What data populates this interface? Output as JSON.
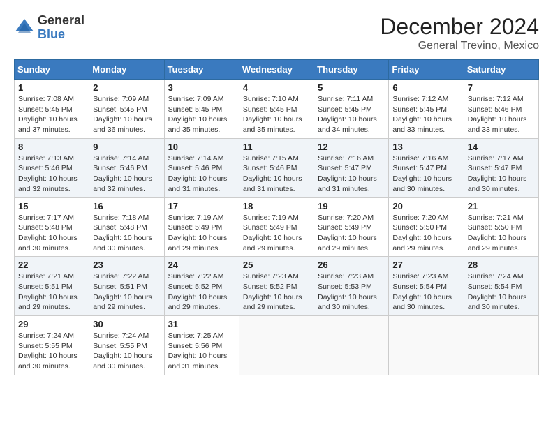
{
  "header": {
    "logo_general": "General",
    "logo_blue": "Blue",
    "month_title": "December 2024",
    "location": "General Trevino, Mexico"
  },
  "calendar": {
    "days_of_week": [
      "Sunday",
      "Monday",
      "Tuesday",
      "Wednesday",
      "Thursday",
      "Friday",
      "Saturday"
    ],
    "weeks": [
      [
        {
          "day": "1",
          "sunrise": "7:08 AM",
          "sunset": "5:45 PM",
          "daylight": "10 hours and 37 minutes."
        },
        {
          "day": "2",
          "sunrise": "7:09 AM",
          "sunset": "5:45 PM",
          "daylight": "10 hours and 36 minutes."
        },
        {
          "day": "3",
          "sunrise": "7:09 AM",
          "sunset": "5:45 PM",
          "daylight": "10 hours and 35 minutes."
        },
        {
          "day": "4",
          "sunrise": "7:10 AM",
          "sunset": "5:45 PM",
          "daylight": "10 hours and 35 minutes."
        },
        {
          "day": "5",
          "sunrise": "7:11 AM",
          "sunset": "5:45 PM",
          "daylight": "10 hours and 34 minutes."
        },
        {
          "day": "6",
          "sunrise": "7:12 AM",
          "sunset": "5:45 PM",
          "daylight": "10 hours and 33 minutes."
        },
        {
          "day": "7",
          "sunrise": "7:12 AM",
          "sunset": "5:46 PM",
          "daylight": "10 hours and 33 minutes."
        }
      ],
      [
        {
          "day": "8",
          "sunrise": "7:13 AM",
          "sunset": "5:46 PM",
          "daylight": "10 hours and 32 minutes."
        },
        {
          "day": "9",
          "sunrise": "7:14 AM",
          "sunset": "5:46 PM",
          "daylight": "10 hours and 32 minutes."
        },
        {
          "day": "10",
          "sunrise": "7:14 AM",
          "sunset": "5:46 PM",
          "daylight": "10 hours and 31 minutes."
        },
        {
          "day": "11",
          "sunrise": "7:15 AM",
          "sunset": "5:46 PM",
          "daylight": "10 hours and 31 minutes."
        },
        {
          "day": "12",
          "sunrise": "7:16 AM",
          "sunset": "5:47 PM",
          "daylight": "10 hours and 31 minutes."
        },
        {
          "day": "13",
          "sunrise": "7:16 AM",
          "sunset": "5:47 PM",
          "daylight": "10 hours and 30 minutes."
        },
        {
          "day": "14",
          "sunrise": "7:17 AM",
          "sunset": "5:47 PM",
          "daylight": "10 hours and 30 minutes."
        }
      ],
      [
        {
          "day": "15",
          "sunrise": "7:17 AM",
          "sunset": "5:48 PM",
          "daylight": "10 hours and 30 minutes."
        },
        {
          "day": "16",
          "sunrise": "7:18 AM",
          "sunset": "5:48 PM",
          "daylight": "10 hours and 30 minutes."
        },
        {
          "day": "17",
          "sunrise": "7:19 AM",
          "sunset": "5:49 PM",
          "daylight": "10 hours and 29 minutes."
        },
        {
          "day": "18",
          "sunrise": "7:19 AM",
          "sunset": "5:49 PM",
          "daylight": "10 hours and 29 minutes."
        },
        {
          "day": "19",
          "sunrise": "7:20 AM",
          "sunset": "5:49 PM",
          "daylight": "10 hours and 29 minutes."
        },
        {
          "day": "20",
          "sunrise": "7:20 AM",
          "sunset": "5:50 PM",
          "daylight": "10 hours and 29 minutes."
        },
        {
          "day": "21",
          "sunrise": "7:21 AM",
          "sunset": "5:50 PM",
          "daylight": "10 hours and 29 minutes."
        }
      ],
      [
        {
          "day": "22",
          "sunrise": "7:21 AM",
          "sunset": "5:51 PM",
          "daylight": "10 hours and 29 minutes."
        },
        {
          "day": "23",
          "sunrise": "7:22 AM",
          "sunset": "5:51 PM",
          "daylight": "10 hours and 29 minutes."
        },
        {
          "day": "24",
          "sunrise": "7:22 AM",
          "sunset": "5:52 PM",
          "daylight": "10 hours and 29 minutes."
        },
        {
          "day": "25",
          "sunrise": "7:23 AM",
          "sunset": "5:52 PM",
          "daylight": "10 hours and 29 minutes."
        },
        {
          "day": "26",
          "sunrise": "7:23 AM",
          "sunset": "5:53 PM",
          "daylight": "10 hours and 30 minutes."
        },
        {
          "day": "27",
          "sunrise": "7:23 AM",
          "sunset": "5:54 PM",
          "daylight": "10 hours and 30 minutes."
        },
        {
          "day": "28",
          "sunrise": "7:24 AM",
          "sunset": "5:54 PM",
          "daylight": "10 hours and 30 minutes."
        }
      ],
      [
        {
          "day": "29",
          "sunrise": "7:24 AM",
          "sunset": "5:55 PM",
          "daylight": "10 hours and 30 minutes."
        },
        {
          "day": "30",
          "sunrise": "7:24 AM",
          "sunset": "5:55 PM",
          "daylight": "10 hours and 30 minutes."
        },
        {
          "day": "31",
          "sunrise": "7:25 AM",
          "sunset": "5:56 PM",
          "daylight": "10 hours and 31 minutes."
        },
        null,
        null,
        null,
        null
      ]
    ]
  }
}
